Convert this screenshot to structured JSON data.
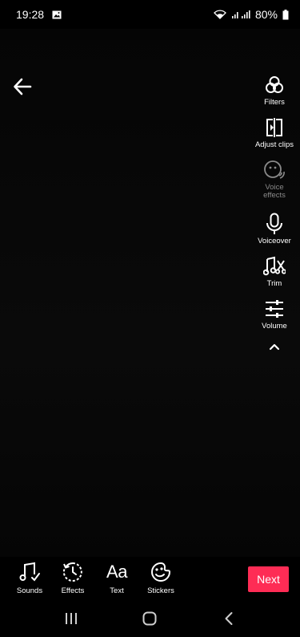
{
  "status_bar": {
    "time": "19:28",
    "battery": "80%",
    "icons": [
      "gallery-icon",
      "wifi-icon",
      "signal-icon",
      "battery-icon"
    ]
  },
  "header": {
    "back_icon": "arrow-left-icon"
  },
  "side_tools": [
    {
      "label": "Filters",
      "icon": "filters-icon",
      "enabled": true
    },
    {
      "label": "Adjust clips",
      "icon": "adjust-clips-icon",
      "enabled": true
    },
    {
      "label": "Voice effects",
      "icon": "voice-effects-icon",
      "enabled": false
    },
    {
      "label": "Voiceover",
      "icon": "microphone-icon",
      "enabled": true
    },
    {
      "label": "Trim",
      "icon": "trim-icon",
      "enabled": true
    },
    {
      "label": "Volume",
      "icon": "volume-sliders-icon",
      "enabled": true
    }
  ],
  "side_tools_collapse_icon": "chevron-up-icon",
  "bottom_tools": [
    {
      "label": "Sounds",
      "icon": "music-note-icon"
    },
    {
      "label": "Effects",
      "icon": "effects-clock-icon"
    },
    {
      "label": "Text",
      "icon": "text-aa-icon",
      "glyph": "Aa"
    },
    {
      "label": "Stickers",
      "icon": "sticker-icon"
    }
  ],
  "next_button": {
    "label": "Next",
    "color": "#fe2c55"
  },
  "nav_bar": {
    "icons": [
      "recent-apps-icon",
      "home-icon",
      "back-icon"
    ]
  }
}
